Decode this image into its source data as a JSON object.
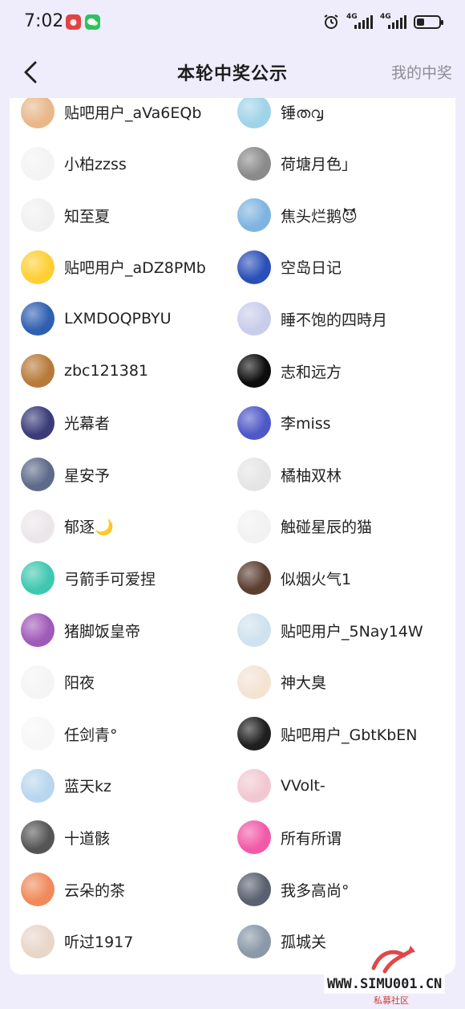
{
  "status": {
    "time": "7:02",
    "signal1": "4G",
    "signal2": "4G"
  },
  "nav": {
    "title": "本轮中奖公示",
    "right_link": "我的中奖"
  },
  "left_users": [
    {
      "name": "贴吧用户_aVa6EQb",
      "avatar_color": "#e8b88a",
      "avatar": "hamster-avatar"
    },
    {
      "name": "小柏zzss",
      "avatar_color": "#f4f4f4",
      "avatar": "small-cat-avatar"
    },
    {
      "name": "知至夏",
      "avatar_color": "#f1f1f1",
      "avatar": "black-figure-avatar"
    },
    {
      "name": "贴吧用户_aDZ8PMb",
      "avatar_color": "#ffcf33",
      "avatar": "duck-avatar"
    },
    {
      "name": "LXMDOQPBYU",
      "avatar_color": "#2f5fb0",
      "avatar": "astronaut-avatar"
    },
    {
      "name": "zbc121381",
      "avatar_color": "#b87a3a",
      "avatar": "cat-avatar"
    },
    {
      "name": "光幕者",
      "avatar_color": "#3b3b7a",
      "avatar": "anime-avatar"
    },
    {
      "name": "星安予",
      "avatar_color": "#5d6a8a",
      "avatar": "scenery-avatar"
    },
    {
      "name": "郁逐🌙",
      "avatar_color": "#ece6ea",
      "avatar": "anime-girl-avatar"
    },
    {
      "name": "弓箭手可爱捏",
      "avatar_color": "#3fc8b0",
      "avatar": "miku-avatar"
    },
    {
      "name": "猪脚饭皇帝",
      "avatar_color": "#a05ab8",
      "avatar": "pink-anime-avatar"
    },
    {
      "name": "阳夜",
      "avatar_color": "#f5f5f5",
      "avatar": "sketch-avatar"
    },
    {
      "name": "任剑青°",
      "avatar_color": "#f7f7f7",
      "avatar": "minimal-avatar"
    },
    {
      "name": "蓝天kz",
      "avatar_color": "#b9d6ee",
      "avatar": "white-cat-avatar"
    },
    {
      "name": "十道骸",
      "avatar_color": "#555555",
      "avatar": "manga-avatar"
    },
    {
      "name": "云朵的茶",
      "avatar_color": "#f08a5a",
      "avatar": "sunset-avatar"
    },
    {
      "name": "听过1917",
      "avatar_color": "#e8d6c8",
      "avatar": "drawing-avatar"
    }
  ],
  "right_users": [
    {
      "name": "锤ത൮",
      "avatar_color": "#9fd3e8",
      "avatar": "doraemon-avatar"
    },
    {
      "name": "荷塘月色」",
      "avatar_color": "#8a8a8a",
      "avatar": "portrait-avatar"
    },
    {
      "name": "焦头烂鹅😈",
      "avatar_color": "#7fb4e0",
      "avatar": "bear-avatar"
    },
    {
      "name": "空岛日记",
      "avatar_color": "#2a4fb8",
      "avatar": "heart-avatar"
    },
    {
      "name": "睡不饱的四時月",
      "avatar_color": "#c9cdea",
      "avatar": "sky-avatar"
    },
    {
      "name": "志和远方",
      "avatar_color": "#0d0d0d",
      "avatar": "night-avatar"
    },
    {
      "name": "李miss",
      "avatar_color": "#4e58c8",
      "avatar": "cow-avatar"
    },
    {
      "name": "橘柚双林",
      "avatar_color": "#e5e5e5",
      "avatar": "grey-anime-avatar"
    },
    {
      "name": "触碰星辰的猫",
      "avatar_color": "#f2f2f2",
      "avatar": "boy-avatar"
    },
    {
      "name": "似烟火气1",
      "avatar_color": "#5a3e30",
      "avatar": "dark-photo-avatar"
    },
    {
      "name": "贴吧用户_5Nay14W",
      "avatar_color": "#cfe2ef",
      "avatar": "bear-avatar-2"
    },
    {
      "name": "神大臭",
      "avatar_color": "#f3e3d3",
      "avatar": "branch-avatar"
    },
    {
      "name": "贴吧用户_GbtKbEN",
      "avatar_color": "#1f1f1f",
      "avatar": "black-text-avatar"
    },
    {
      "name": "VVolt-",
      "avatar_color": "#f2c8d0",
      "avatar": "pink-girl-avatar"
    },
    {
      "name": "所有所谓",
      "avatar_color": "#f25aa8",
      "avatar": "pink-cat-avatar"
    },
    {
      "name": "我多高尚°",
      "avatar_color": "#5a6070",
      "avatar": "man-photo-avatar"
    },
    {
      "name": "孤城关",
      "avatar_color": "#8a98a8",
      "avatar": "lake-avatar"
    }
  ],
  "watermark": {
    "url": "WWW.SIMU001.CN",
    "sub": "私募社区"
  }
}
